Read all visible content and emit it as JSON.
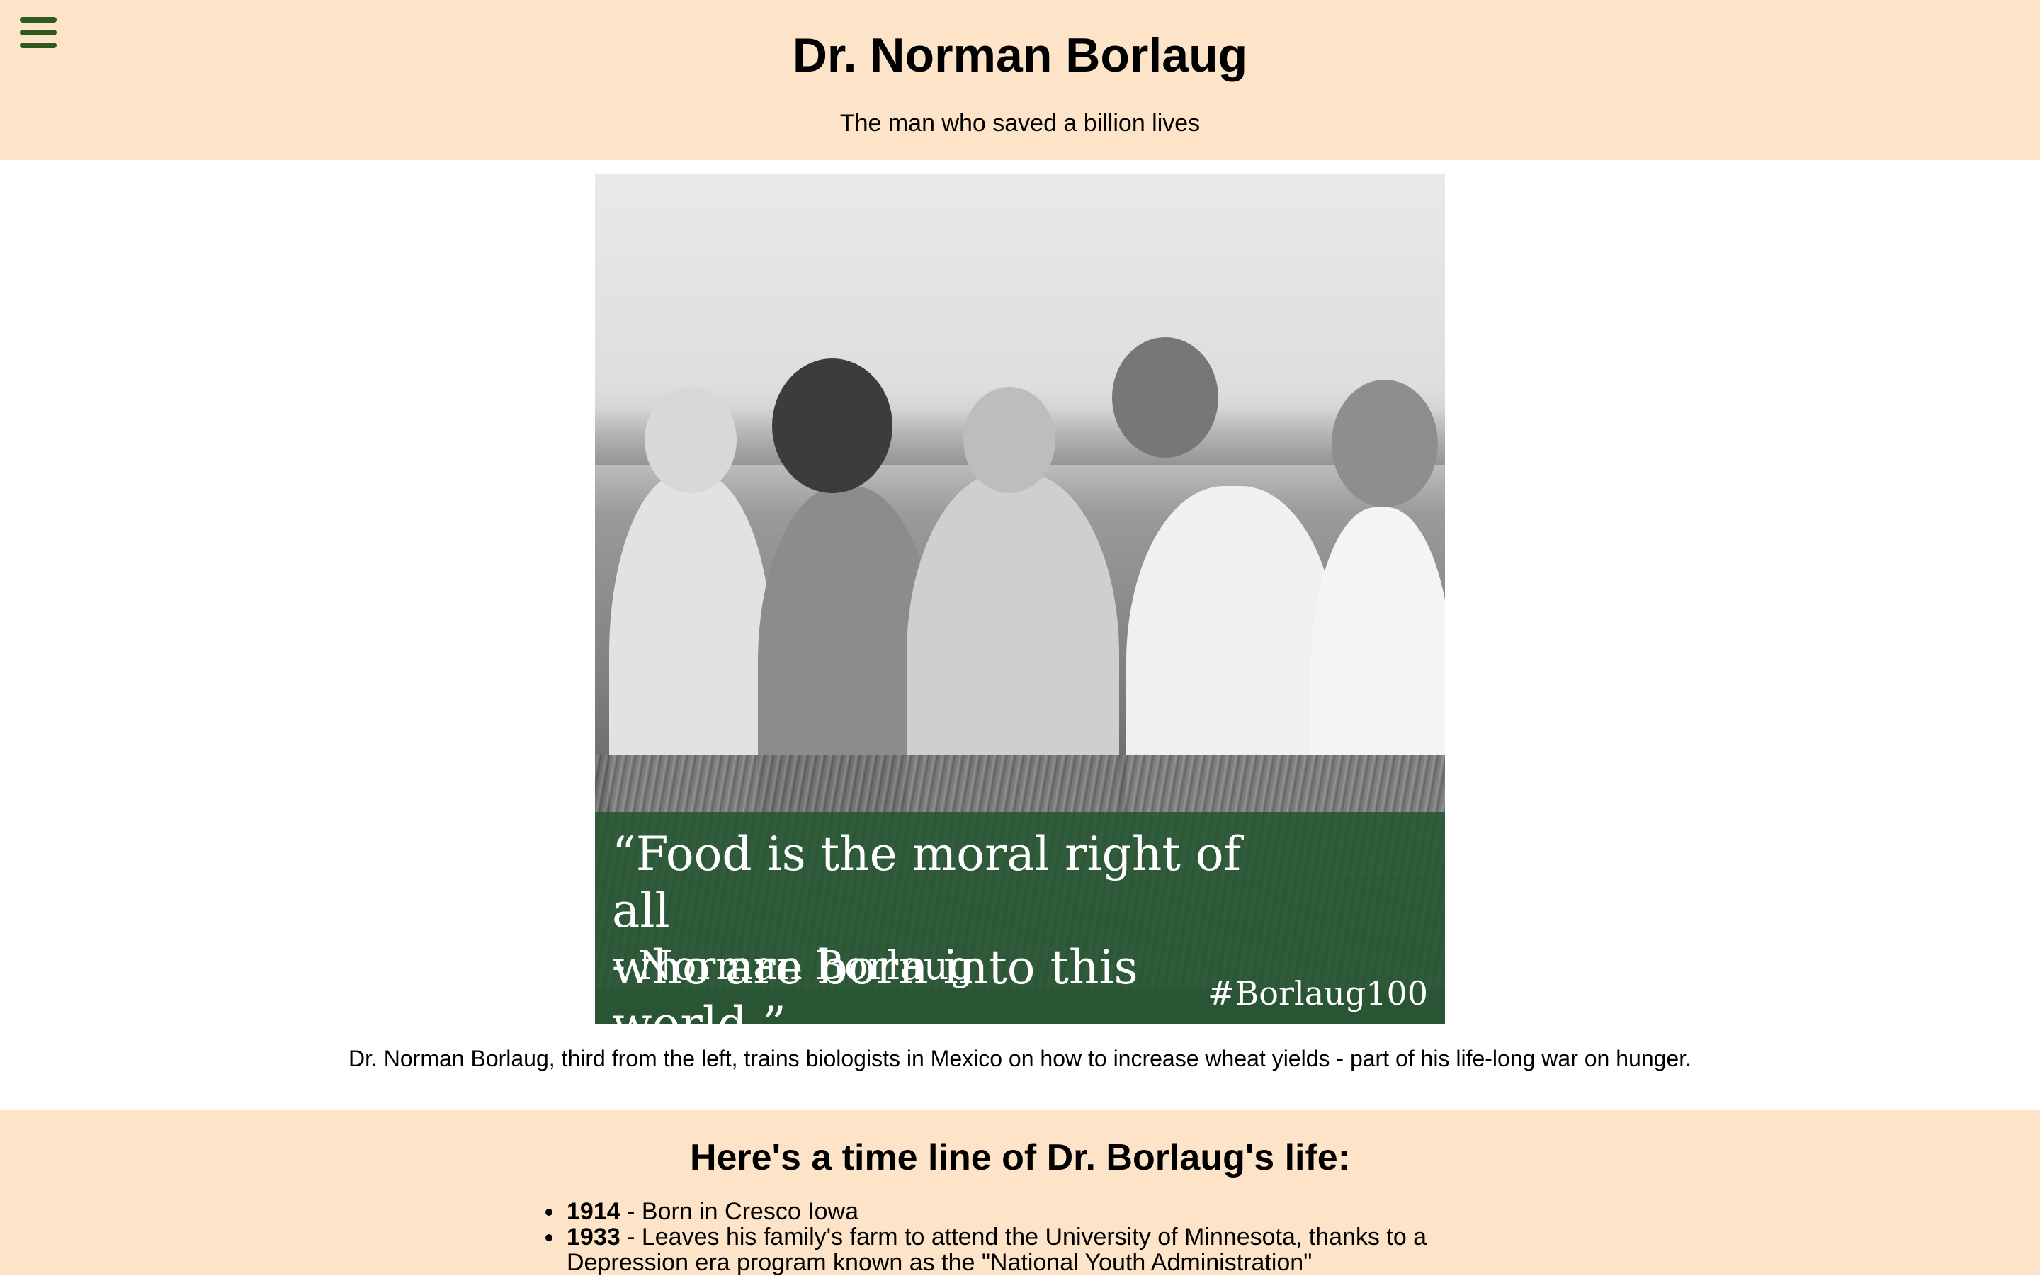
{
  "colors": {
    "header_bg": "#fde4c8",
    "timeline_bg": "#fde4c8",
    "page_bg": "#ffffff",
    "menu_icon": "#2f5a1e",
    "quote_band": "#265632"
  },
  "menu": {
    "icon": "hamburger-menu-icon"
  },
  "header": {
    "title": "Dr. Norman Borlaug",
    "subtitle": "The man who saved a billion lives"
  },
  "photo": {
    "quote_line1": "“Food is the moral right of all",
    "quote_line2": "who are born into this world.”",
    "quote_attribution": "- Norman Borlaug",
    "hashtag": "#Borlaug100"
  },
  "caption": "Dr. Norman Borlaug, third from the left, trains biologists in Mexico on how to increase wheat yields - part of his life-long war on hunger.",
  "timeline": {
    "heading": "Here's a time line of Dr. Borlaug's life:",
    "items": [
      {
        "year": "1914",
        "text": " - Born in Cresco Iowa"
      },
      {
        "year": "1933",
        "text": " - Leaves his family's farm to attend the University of Minnesota, thanks to a Depression era program known as the \"National Youth Administration\""
      }
    ]
  }
}
